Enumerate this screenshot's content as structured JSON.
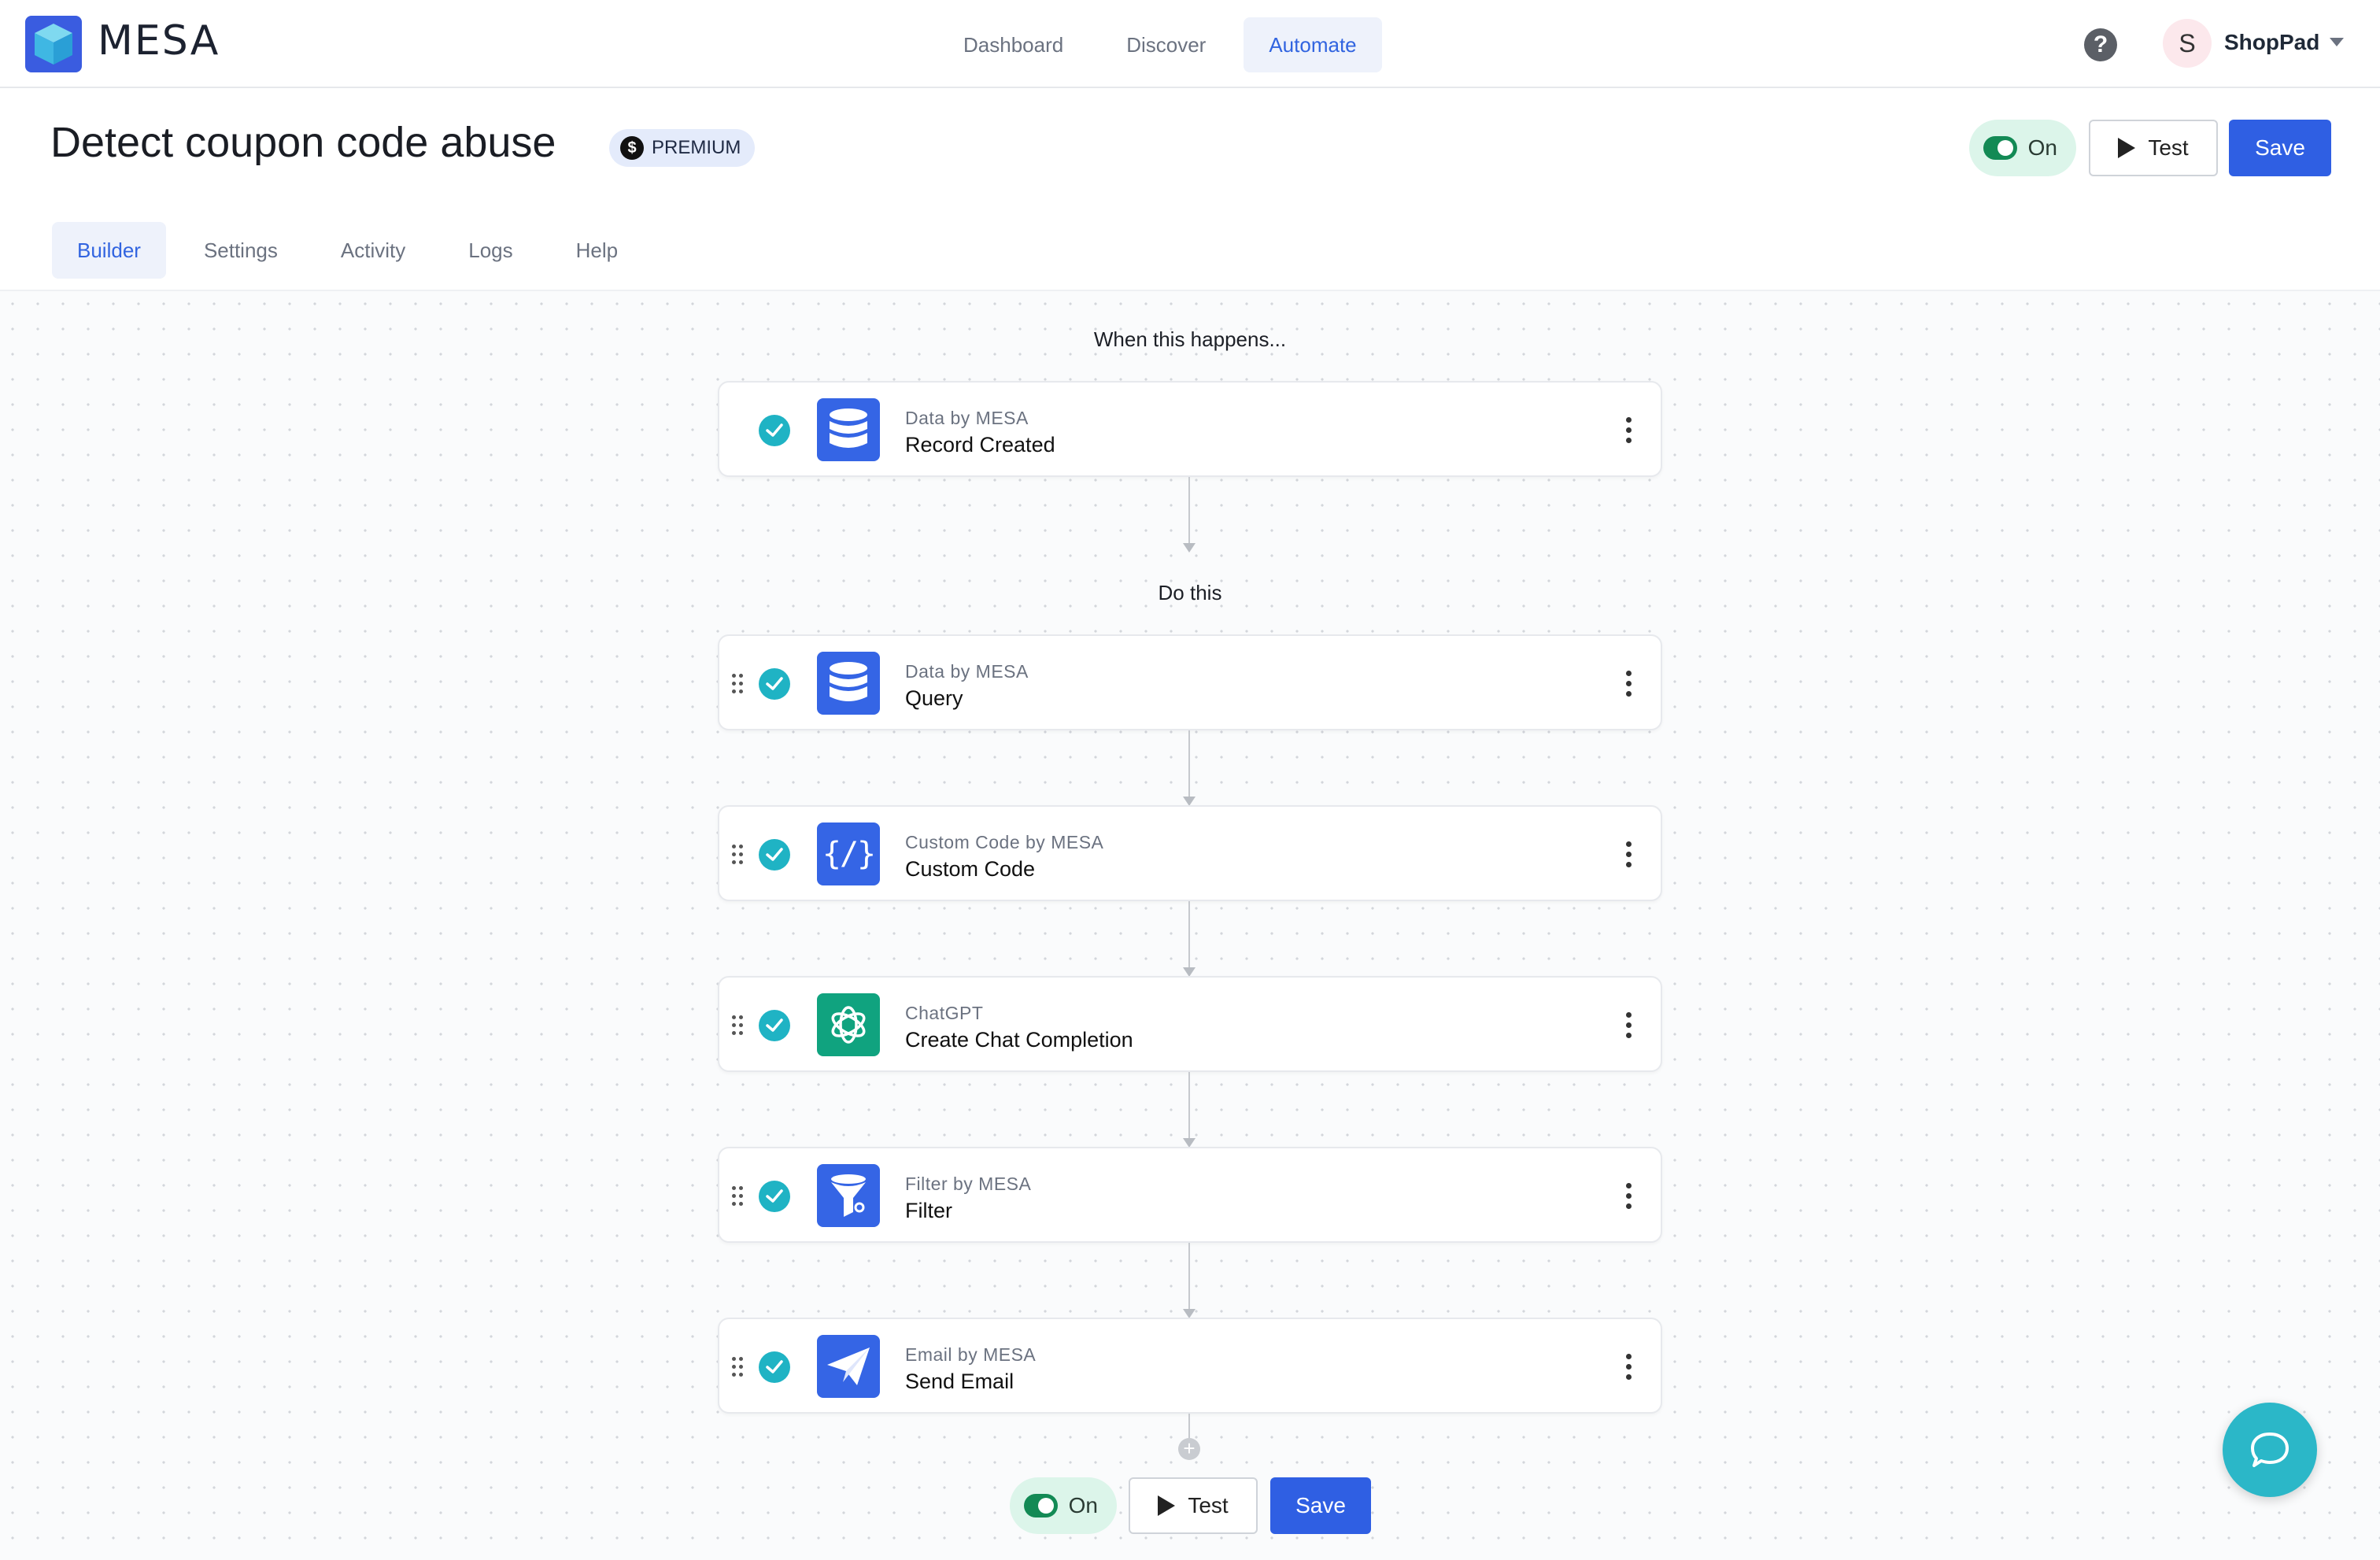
{
  "brand": {
    "name": "MESA"
  },
  "nav": {
    "items": [
      {
        "label": "Dashboard",
        "active": false
      },
      {
        "label": "Discover",
        "active": false
      },
      {
        "label": "Automate",
        "active": true
      }
    ]
  },
  "account": {
    "initial": "S",
    "name": "ShopPad"
  },
  "header": {
    "title": "Detect coupon code abuse",
    "badge": "PREMIUM",
    "badge_icon": "$",
    "toggle_label": "On",
    "toggle_on": true,
    "test_label": "Test",
    "save_label": "Save"
  },
  "tabs": [
    {
      "label": "Builder",
      "active": true
    },
    {
      "label": "Settings",
      "active": false
    },
    {
      "label": "Activity",
      "active": false
    },
    {
      "label": "Logs",
      "active": false
    },
    {
      "label": "Help",
      "active": false
    }
  ],
  "workflow": {
    "trigger_label": "When this happens...",
    "actions_label": "Do this",
    "trigger": {
      "app": "Data by MESA",
      "step": "Record Created",
      "icon": "database-icon"
    },
    "steps": [
      {
        "app": "Data by MESA",
        "step": "Query",
        "icon": "database-icon"
      },
      {
        "app": "Custom Code by MESA",
        "step": "Custom Code",
        "icon": "code-icon"
      },
      {
        "app": "ChatGPT",
        "step": "Create Chat Completion",
        "icon": "openai-icon"
      },
      {
        "app": "Filter by MESA",
        "step": "Filter",
        "icon": "funnel-icon"
      },
      {
        "app": "Email by MESA",
        "step": "Send Email",
        "icon": "paper-plane-icon"
      }
    ]
  },
  "footer": {
    "toggle_label": "On",
    "test_label": "Test",
    "save_label": "Save"
  },
  "colors": {
    "primary": "#2f5fe3",
    "accent_teal": "#1fb3c4",
    "toggle_green": "#138a55",
    "chatgpt_green": "#10a37f"
  }
}
